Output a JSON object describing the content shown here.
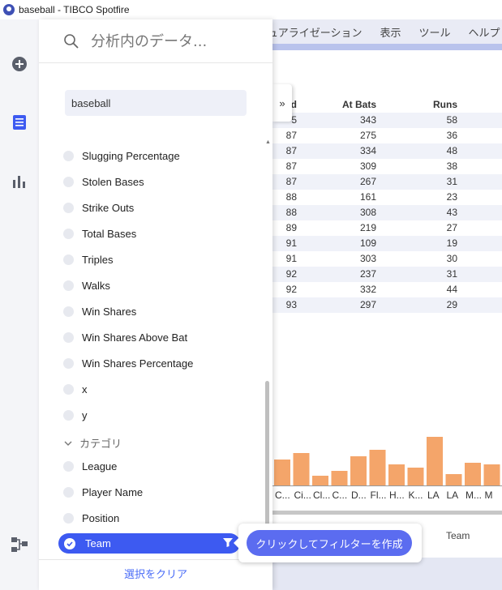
{
  "window": {
    "title": "baseball - TIBCO Spotfire"
  },
  "menubar": {
    "items": [
      "ュアライゼーション",
      "表示",
      "ツール",
      "ヘルプ"
    ]
  },
  "table": {
    "headers": [
      "d",
      "At Bats",
      "Runs"
    ],
    "rows": [
      [
        "5",
        "343",
        "58"
      ],
      [
        "87",
        "275",
        "36"
      ],
      [
        "87",
        "334",
        "48"
      ],
      [
        "87",
        "309",
        "38"
      ],
      [
        "87",
        "267",
        "31"
      ],
      [
        "88",
        "161",
        "23"
      ],
      [
        "88",
        "308",
        "43"
      ],
      [
        "89",
        "219",
        "27"
      ],
      [
        "91",
        "109",
        "19"
      ],
      [
        "91",
        "303",
        "30"
      ],
      [
        "92",
        "237",
        "31"
      ],
      [
        "92",
        "332",
        "44"
      ],
      [
        "93",
        "297",
        "29"
      ]
    ]
  },
  "chart_data": {
    "type": "bar",
    "categories": [
      "C...",
      "Ci...",
      "Cl...",
      "C...",
      "D...",
      "Fl...",
      "H...",
      "K...",
      "LA",
      "LA",
      "M...",
      "M"
    ],
    "values": [
      32,
      40,
      12,
      18,
      36,
      44,
      26,
      22,
      60,
      14,
      28,
      26
    ],
    "color": "#f4a56a"
  },
  "bg": {
    "team_header": "Team",
    "collapse_label": "»"
  },
  "panel": {
    "search_placeholder": "分析内のデータ...",
    "source": "baseball",
    "items": [
      "Slugging Percentage",
      "Stolen Bases",
      "Strike Outs",
      "Total Bases",
      "Triples",
      "Walks",
      "Win Shares",
      "Win Shares Above Bat",
      "Win Shares Percentage",
      "x",
      "y"
    ],
    "category_section": "カテゴリ",
    "category_items": [
      "League",
      "Player Name",
      "Position"
    ],
    "selected_item": "Team",
    "clear_label": "選択をクリア"
  },
  "tooltip": {
    "label": "クリックしてフィルターを作成"
  },
  "colors": {
    "accent": "#3d5af1",
    "bar": "#f4a56a",
    "link": "#4a6cf7"
  }
}
